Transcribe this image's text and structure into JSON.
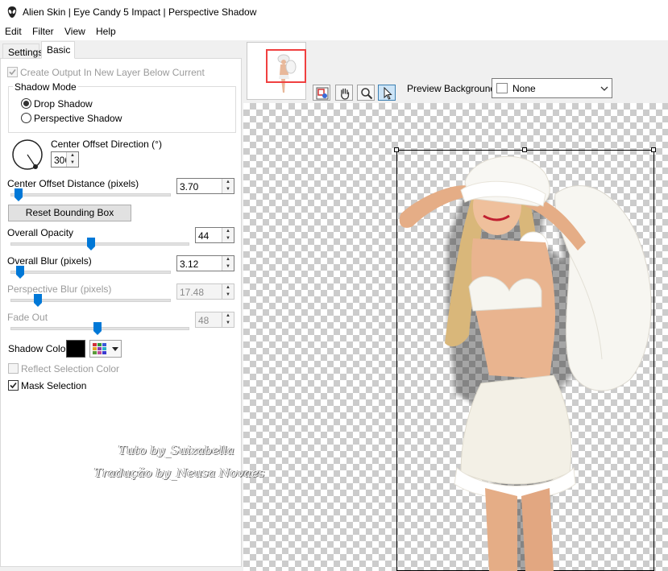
{
  "window": {
    "title": "Alien Skin | Eye Candy 5 Impact | Perspective Shadow"
  },
  "menu": {
    "items": [
      "Edit",
      "Filter",
      "View",
      "Help"
    ]
  },
  "tabs": {
    "settings": "Settings",
    "basic": "Basic"
  },
  "basic": {
    "create_output_label": "Create Output In New Layer Below Current",
    "create_output_checked": true,
    "shadow_mode": {
      "label": "Shadow Mode",
      "options": [
        "Drop Shadow",
        "Perspective Shadow"
      ],
      "selected": "Drop Shadow"
    },
    "center_offset_direction": {
      "label": "Center Offset Direction (°)",
      "value": "306"
    },
    "center_offset_distance": {
      "label": "Center Offset Distance (pixels)",
      "value": "3.70"
    },
    "reset_button": "Reset Bounding Box",
    "overall_opacity": {
      "label": "Overall Opacity",
      "value": "44"
    },
    "overall_blur": {
      "label": "Overall Blur (pixels)",
      "value": "3.12"
    },
    "perspective_blur": {
      "label": "Perspective Blur (pixels)",
      "value": "17.48"
    },
    "fade_out": {
      "label": "Fade Out",
      "value": "48"
    },
    "shadow_color": {
      "label": "Shadow Color",
      "value": "#000000"
    },
    "reflect_selection": {
      "label": "Reflect Selection Color",
      "checked": false
    },
    "mask_selection": {
      "label": "Mask Selection",
      "checked": true
    }
  },
  "preview": {
    "background_label": "Preview Background:",
    "background_value": "None",
    "tools": [
      "navigate-icon",
      "hand-icon",
      "zoom-icon",
      "pointer-icon"
    ]
  },
  "watermark": {
    "line1": "Tuto by_Suizabella",
    "line2": "Tradução by_Neusa Novaes"
  }
}
